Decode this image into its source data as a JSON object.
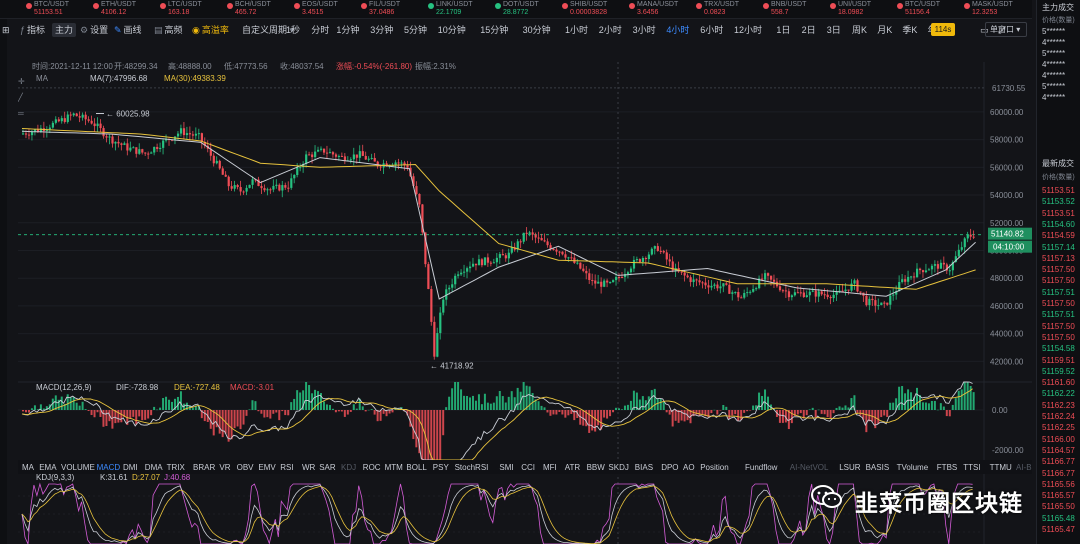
{
  "ticker": [
    {
      "symbol": "BTC/USDT",
      "price": "51153.51",
      "dir": "dn"
    },
    {
      "symbol": "ETH/USDT",
      "price": "4106.12",
      "dir": "dn"
    },
    {
      "symbol": "LTC/USDT",
      "price": "163.18",
      "dir": "dn"
    },
    {
      "symbol": "BCH/USDT",
      "price": "465.72",
      "dir": "dn"
    },
    {
      "symbol": "EOS/USDT",
      "price": "3.4515",
      "dir": "dn"
    },
    {
      "symbol": "FIL/USDT",
      "price": "37.0486",
      "dir": "dn"
    },
    {
      "symbol": "LINK/USDT",
      "price": "22.1709",
      "dir": "up"
    },
    {
      "symbol": "DOT/USDT",
      "price": "28.8772",
      "dir": "up"
    },
    {
      "symbol": "SHIB/USDT",
      "price": "0.00003828",
      "dir": "dn"
    },
    {
      "symbol": "MANA/USDT",
      "price": "3.6456",
      "dir": "dn"
    },
    {
      "symbol": "TRX/USDT",
      "price": "0.0823",
      "dir": "dn"
    },
    {
      "symbol": "BNB/USDT",
      "price": "558.7",
      "dir": "dn"
    },
    {
      "symbol": "UNI/USDT",
      "price": "18.0982",
      "dir": "dn"
    },
    {
      "symbol": "BTC/USDT",
      "price": "51156.4",
      "dir": "dn"
    },
    {
      "symbol": "MASK/USDT",
      "price": "12.3253",
      "dir": "dn"
    }
  ],
  "toolbar": {
    "indicator": "指标",
    "main": "主力",
    "settings": "设置",
    "draw": "画线",
    "hq": "高频",
    "premium": "高溢率",
    "custom_period": "自定义周期",
    "periods": [
      "1秒",
      "分时",
      "1分钟",
      "3分钟",
      "5分钟",
      "10分钟",
      "15分钟",
      "30分钟",
      "1小时",
      "2小时",
      "3小时",
      "4小时",
      "6小时",
      "12小时",
      "1日",
      "2日",
      "3日",
      "周K",
      "月K",
      "季K",
      "年K"
    ],
    "selected_period": "4小时",
    "badge": "114s",
    "layout": "单窗口"
  },
  "ohlc": {
    "time": "时间:2021-12-11 12:00",
    "open": "开:48299.34",
    "high": "高:48888.00",
    "low": "低:47773.56",
    "close": "收:48037.54",
    "change": "涨幅:-0.54%(-261.80)",
    "amplitude": "振幅:2.31%"
  },
  "ma_legend": {
    "ma": "MA",
    "ma7": "MA(7):47996.68",
    "ma30": "MA(30):49383.39"
  },
  "annotations": {
    "high": "60025.98",
    "low": "41718.92"
  },
  "price_axis": {
    "ticks": [
      "60000.00",
      "58000.00",
      "56000.00",
      "54000.00",
      "52000.00",
      "50000.00",
      "48000.00",
      "46000.00",
      "44000.00",
      "42000.00"
    ],
    "top_price": "61730.55",
    "current_price": "51140.82",
    "countdown": "04:10:00"
  },
  "macd": {
    "title": "MACD(12,26,9)",
    "dif": "DIF:-728.98",
    "dea": "DEA:-727.48",
    "macd": "MACD:-3.01",
    "ticks": [
      "0.00",
      "-2000.00"
    ]
  },
  "indicator_tabs": [
    "MA",
    "EMA",
    "VOLUME",
    "MACD",
    "DMI",
    "DMA",
    "TRIX",
    "BRAR",
    "VR",
    "OBV",
    "EMV",
    "RSI",
    "WR",
    "SAR",
    "KDJ",
    "ROC",
    "MTM",
    "BOLL",
    "PSY",
    "StochRSI",
    "SMI",
    "CCI",
    "MFI",
    "ATR",
    "BBW",
    "SKDJ",
    "BIAS",
    "DPO",
    "AO",
    "Position",
    "Fundflow",
    "AI-NetVOL",
    "LSUR",
    "BASIS",
    "TVolume",
    "FTBS",
    "TTSI",
    "TTMU",
    "AI-BDI"
  ],
  "indicator_selected": "MACD",
  "kdj": {
    "title": "KDJ(9,3,3)",
    "k": "K:31.61",
    "d": "D:27.07",
    "j": "J:40.68"
  },
  "right_panel": {
    "main_trades": "主力成交",
    "price_qty": "价格(数量)",
    "latest_trades": "最新成交",
    "price_label": "价格(数量)",
    "masked": [
      "5******",
      "4******",
      "5******",
      "4******",
      "4******",
      "5******",
      "4******"
    ],
    "trades": [
      {
        "p": "51153.51",
        "d": "dn"
      },
      {
        "p": "51153.52",
        "d": "up"
      },
      {
        "p": "51153.51",
        "d": "dn"
      },
      {
        "p": "51154.60",
        "d": "up"
      },
      {
        "p": "51154.59",
        "d": "dn"
      },
      {
        "p": "51157.14",
        "d": "up"
      },
      {
        "p": "51157.13",
        "d": "dn"
      },
      {
        "p": "51157.50",
        "d": "dn"
      },
      {
        "p": "51157.50",
        "d": "dn"
      },
      {
        "p": "51157.51",
        "d": "up"
      },
      {
        "p": "51157.50",
        "d": "dn"
      },
      {
        "p": "51157.51",
        "d": "up"
      },
      {
        "p": "51157.50",
        "d": "dn"
      },
      {
        "p": "51157.50",
        "d": "dn"
      },
      {
        "p": "51154.58",
        "d": "up"
      },
      {
        "p": "51159.51",
        "d": "dn"
      },
      {
        "p": "51159.52",
        "d": "up"
      },
      {
        "p": "51161.60",
        "d": "dn"
      },
      {
        "p": "51162.22",
        "d": "up"
      },
      {
        "p": "51162.23",
        "d": "dn"
      },
      {
        "p": "51162.24",
        "d": "dn"
      },
      {
        "p": "51162.25",
        "d": "dn"
      },
      {
        "p": "51166.00",
        "d": "dn"
      },
      {
        "p": "51164.57",
        "d": "dn"
      },
      {
        "p": "51166.77",
        "d": "dn"
      },
      {
        "p": "51166.77",
        "d": "dn"
      },
      {
        "p": "51165.56",
        "d": "dn"
      },
      {
        "p": "51165.57",
        "d": "dn"
      },
      {
        "p": "51165.50",
        "d": "dn"
      },
      {
        "p": "51165.48",
        "d": "up"
      },
      {
        "p": "51165.47",
        "d": "dn"
      }
    ]
  },
  "watermark": "韭菜币圈区块链",
  "colors": {
    "up": "#26c281",
    "down": "#ef4d56",
    "ma7": "#c8ccd4",
    "ma30": "#e7c23d",
    "accent": "#3d8bff",
    "badge": "#f0b90b",
    "bg": "#131418"
  },
  "chart_data": {
    "type": "candlestick",
    "title": "BTC/USDT",
    "interval": "4小时",
    "ylim": [
      40800,
      62300
    ],
    "price_path": [
      [
        0,
        58400
      ],
      [
        6,
        58700
      ],
      [
        12,
        59200
      ],
      [
        18,
        59800
      ],
      [
        24,
        59300
      ],
      [
        30,
        58100
      ],
      [
        36,
        57400
      ],
      [
        42,
        57000
      ],
      [
        48,
        57800
      ],
      [
        54,
        58600
      ],
      [
        60,
        58200
      ],
      [
        66,
        56200
      ],
      [
        70,
        54700
      ],
      [
        74,
        54300
      ],
      [
        78,
        55000
      ],
      [
        84,
        54400
      ],
      [
        90,
        54700
      ],
      [
        96,
        56800
      ],
      [
        102,
        57200
      ],
      [
        108,
        56700
      ],
      [
        114,
        56900
      ],
      [
        120,
        56200
      ],
      [
        126,
        56400
      ],
      [
        130,
        56100
      ],
      [
        134,
        53200
      ],
      [
        137,
        47100
      ],
      [
        139,
        42600
      ],
      [
        142,
        46600
      ],
      [
        147,
        48500
      ],
      [
        152,
        49100
      ],
      [
        158,
        49300
      ],
      [
        164,
        49700
      ],
      [
        170,
        51300
      ],
      [
        176,
        50500
      ],
      [
        182,
        49900
      ],
      [
        188,
        48700
      ],
      [
        192,
        47700
      ],
      [
        198,
        47500
      ],
      [
        206,
        49100
      ],
      [
        214,
        50200
      ],
      [
        220,
        48500
      ],
      [
        226,
        47800
      ],
      [
        232,
        47500
      ],
      [
        236,
        47400
      ],
      [
        242,
        46600
      ],
      [
        250,
        48100
      ],
      [
        258,
        46900
      ],
      [
        266,
        46900
      ],
      [
        274,
        46800
      ],
      [
        280,
        47600
      ],
      [
        284,
        46300
      ],
      [
        290,
        46000
      ],
      [
        296,
        47800
      ],
      [
        302,
        48600
      ],
      [
        308,
        48900
      ],
      [
        312,
        48700
      ],
      [
        316,
        50300
      ],
      [
        318,
        51000
      ],
      [
        320,
        51140
      ]
    ],
    "ma7": [
      [
        0,
        58600
      ],
      [
        30,
        58400
      ],
      [
        60,
        57800
      ],
      [
        80,
        54900
      ],
      [
        100,
        56700
      ],
      [
        130,
        55900
      ],
      [
        140,
        46500
      ],
      [
        160,
        48800
      ],
      [
        180,
        50300
      ],
      [
        200,
        48200
      ],
      [
        230,
        48700
      ],
      [
        260,
        47300
      ],
      [
        290,
        46700
      ],
      [
        310,
        48600
      ],
      [
        320,
        50600
      ]
    ],
    "ma30": [
      [
        0,
        58800
      ],
      [
        40,
        58400
      ],
      [
        60,
        57900
      ],
      [
        80,
        56300
      ],
      [
        100,
        56000
      ],
      [
        132,
        56200
      ],
      [
        140,
        54300
      ],
      [
        160,
        50500
      ],
      [
        180,
        49300
      ],
      [
        210,
        49100
      ],
      [
        240,
        47600
      ],
      [
        270,
        47600
      ],
      [
        300,
        47200
      ],
      [
        320,
        48600
      ]
    ],
    "macd_ylim": [
      -2500,
      1400
    ],
    "kdj_ylim": [
      0,
      100
    ]
  }
}
